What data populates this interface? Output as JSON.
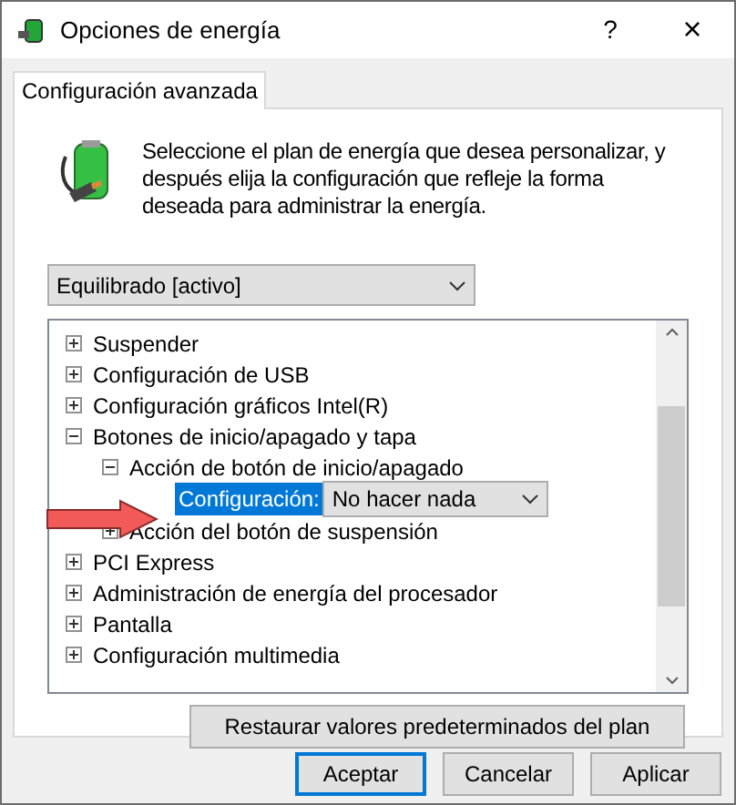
{
  "window": {
    "title": "Opciones de energía",
    "help": "?",
    "close": "×"
  },
  "tabs": [
    {
      "label": "Configuración avanzada",
      "selected": true
    }
  ],
  "description": "Seleccione el plan de energía que desea personalizar, y después elija la configuración que refleje la forma deseada para administrar la energía.",
  "plan_select": {
    "value": "Equilibrado [activo]"
  },
  "tree": [
    {
      "label": "Suspender",
      "expanded": false
    },
    {
      "label": "Configuración de USB",
      "expanded": false
    },
    {
      "label": "Configuración gráficos Intel(R)",
      "expanded": false
    },
    {
      "label": "Botones de inicio/apagado y tapa",
      "expanded": true,
      "children": [
        {
          "label": "Acción de botón de inicio/apagado",
          "expanded": true,
          "children": [
            {
              "kind": "setting",
              "label": "Configuración:",
              "value": "No hacer nada",
              "selected": true
            }
          ]
        },
        {
          "label": "Acción del botón de suspensión",
          "expanded": false
        }
      ]
    },
    {
      "label": "PCI Express",
      "expanded": false
    },
    {
      "label": "Administración de energía del procesador",
      "expanded": false
    },
    {
      "label": "Pantalla",
      "expanded": false
    },
    {
      "label": "Configuración multimedia",
      "expanded": false
    }
  ],
  "restore_button": "Restaurar valores predeterminados del plan",
  "buttons": [
    {
      "label": "Aceptar",
      "default": true
    },
    {
      "label": "Cancelar",
      "default": false
    },
    {
      "label": "Aplicar",
      "default": false
    }
  ]
}
